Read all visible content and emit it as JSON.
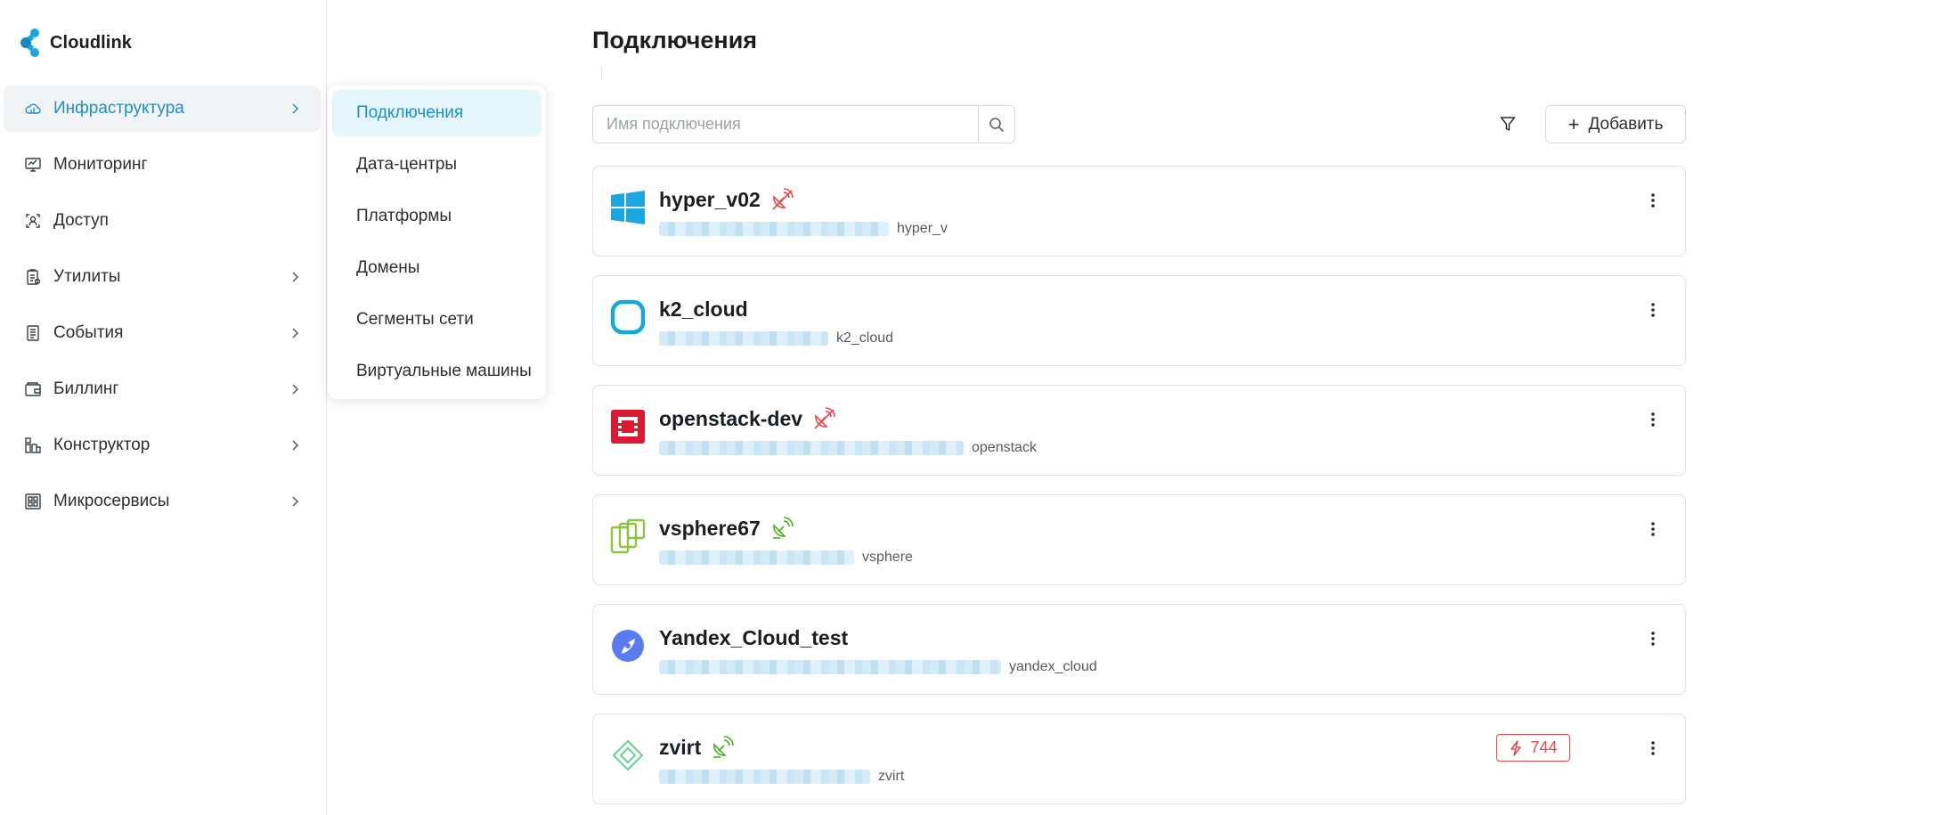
{
  "brand": {
    "name": "Cloudlink"
  },
  "sidebar": {
    "items": [
      {
        "label": "Инфраструктура",
        "icon": "cloud-icon"
      },
      {
        "label": "Мониторинг",
        "icon": "monitor-icon"
      },
      {
        "label": "Доступ",
        "icon": "access-icon"
      },
      {
        "label": "Утилиты",
        "icon": "tools-icon"
      },
      {
        "label": "События",
        "icon": "events-icon"
      },
      {
        "label": "Биллинг",
        "icon": "wallet-icon"
      },
      {
        "label": "Конструктор",
        "icon": "constructor-icon"
      },
      {
        "label": "Микросервисы",
        "icon": "microservices-icon"
      }
    ]
  },
  "submenu": {
    "items": [
      {
        "label": "Подключения"
      },
      {
        "label": "Дата-центры"
      },
      {
        "label": "Платформы"
      },
      {
        "label": "Домены"
      },
      {
        "label": "Сегменты сети"
      },
      {
        "label": "Виртуальные машины"
      }
    ]
  },
  "main": {
    "title": "Подключения",
    "search": {
      "placeholder": "Имя подключения",
      "value": ""
    },
    "add_label": "Добавить"
  },
  "connections": [
    {
      "name": "hyper_v02",
      "type": "hyper_v",
      "logo": "windows-logo-icon",
      "status": "disconnected",
      "status_color": "#e8474d"
    },
    {
      "name": "k2_cloud",
      "type": "k2_cloud",
      "logo": "k2-cloud-logo-icon",
      "status": "none"
    },
    {
      "name": "openstack-dev",
      "type": "openstack",
      "logo": "openstack-logo-icon",
      "status": "disconnected",
      "status_color": "#e8474d"
    },
    {
      "name": "vsphere67",
      "type": "vsphere",
      "logo": "vsphere-logo-icon",
      "status": "connected",
      "status_color": "#4caf1f"
    },
    {
      "name": "Yandex_Cloud_test",
      "type": "yandex_cloud",
      "logo": "yandex-cloud-logo-icon",
      "status": "none"
    },
    {
      "name": "zvirt",
      "type": "zvirt",
      "logo": "zvirt-logo-icon",
      "status": "connected",
      "status_color": "#4caf1f",
      "alert_count": "744"
    }
  ],
  "colors": {
    "accent": "#1892c8",
    "danger": "#e8474d",
    "success": "#4caf1f"
  }
}
